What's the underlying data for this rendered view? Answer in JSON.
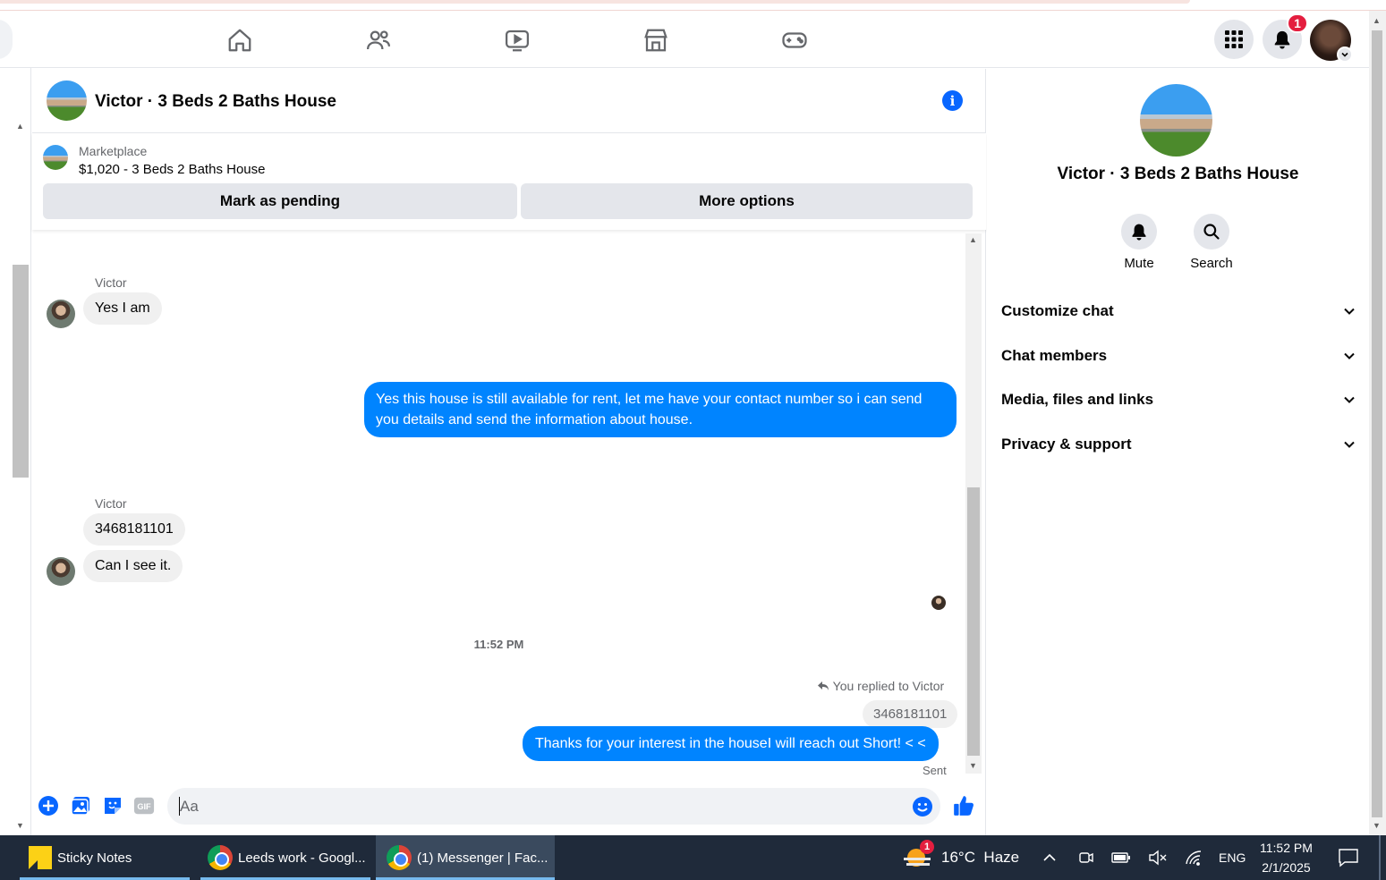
{
  "chat": {
    "title": "Victor · 3 Beds 2 Baths House",
    "marketplace_label": "Marketplace",
    "listing_price_title": "$1,020 - 3 Beds 2 Baths House",
    "mark_pending_label": "Mark as pending",
    "more_options_label": "More options"
  },
  "messages": [
    {
      "from": "Victor",
      "sender_label": "Victor",
      "text": "Yes I am"
    },
    {
      "from": "me",
      "text": "Yes this house is still available for rent, let me have your contact number so i can send you details and send the information about house."
    },
    {
      "from": "Victor",
      "sender_label": "Victor",
      "text": "3468181101"
    },
    {
      "from": "Victor",
      "text": "Can I see it."
    }
  ],
  "timestamp": "11:52 PM",
  "reply": {
    "label": "You replied to Victor",
    "quoted": "3468181101",
    "text": "Thanks for your interest in the houseI will reach out Short! < <",
    "status": "Sent"
  },
  "composer": {
    "placeholder": "Aa",
    "gif_label": "GIF"
  },
  "info_pane": {
    "name": "Victor · 3 Beds 2 Baths House",
    "actions": [
      "Mute",
      "Search"
    ],
    "sections": [
      "Customize chat",
      "Chat members",
      "Media, files and links",
      "Privacy & support"
    ]
  },
  "nav": {
    "notification_count": "1"
  },
  "taskbar": {
    "tasks": [
      "Sticky Notes",
      "Leeds work - Googl...",
      "(1) Messenger | Fac..."
    ],
    "weather": "16°C  Haze",
    "weather_badge": "1",
    "language": "ENG",
    "time": "11:52 PM",
    "date": "2/1/2025"
  },
  "colors": {
    "accent": "#0084ff",
    "brand_blue": "#0866ff",
    "badge_red": "#e41e3f",
    "taskbar": "#1f2a3a"
  }
}
